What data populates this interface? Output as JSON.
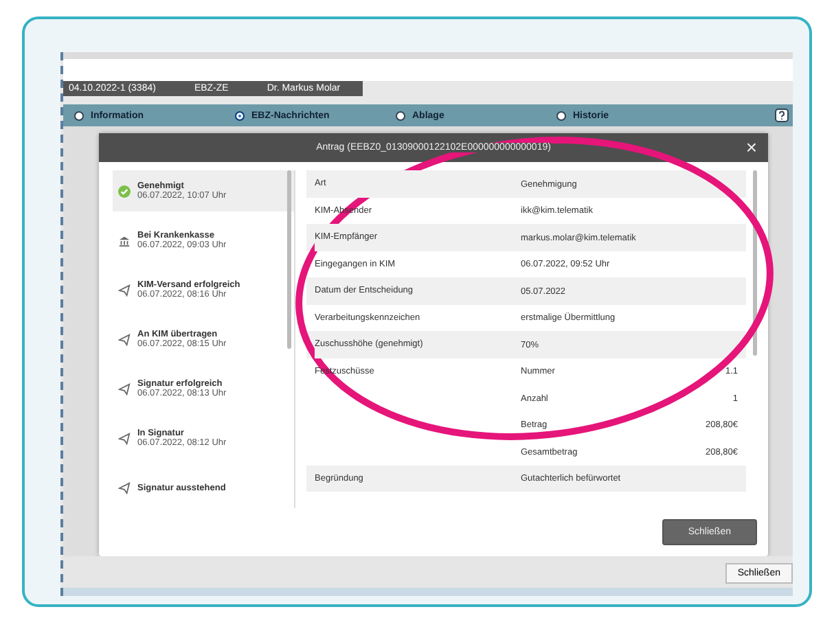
{
  "header": {
    "case": "04.10.2022-1 (3384)",
    "type": "EBZ-ZE",
    "doctor": "Dr. Markus Molar"
  },
  "tabs": [
    {
      "label": "Information",
      "selected": false
    },
    {
      "label": "EBZ-Nachrichten",
      "selected": true
    },
    {
      "label": "Ablage",
      "selected": false
    },
    {
      "label": "Historie",
      "selected": false
    }
  ],
  "dialog": {
    "title": "Antrag (EEBZ0_01309000122102E000000000000019)",
    "close": "×",
    "button": "Schließen"
  },
  "timeline": [
    {
      "kind": "done",
      "title": "Genehmigt",
      "time": "06.07.2022, 10:07 Uhr",
      "selected": true
    },
    {
      "kind": "bank",
      "title": "Bei Krankenkasse",
      "time": "06.07.2022, 09:03 Uhr",
      "selected": false
    },
    {
      "kind": "send",
      "title": "KIM-Versand erfolgreich",
      "time": "06.07.2022, 08:16 Uhr",
      "selected": false
    },
    {
      "kind": "send",
      "title": "An KIM übertragen",
      "time": "06.07.2022, 08:15 Uhr",
      "selected": false
    },
    {
      "kind": "send",
      "title": "Signatur erfolgreich",
      "time": "06.07.2022, 08:13 Uhr",
      "selected": false
    },
    {
      "kind": "send",
      "title": "In Signatur",
      "time": "06.07.2022, 08:12 Uhr",
      "selected": false
    },
    {
      "kind": "send",
      "title": "Signatur ausstehend",
      "selected": false
    }
  ],
  "details": [
    {
      "label": "Art",
      "value": "Genehmigung"
    },
    {
      "label": "KIM-Absender",
      "value": "ikk@kim.telematik"
    },
    {
      "label": "KIM-Empfänger",
      "value": "markus.molar@kim.telematik"
    },
    {
      "label": "Eingegangen in KIM",
      "value": "06.07.2022, 09:52 Uhr"
    },
    {
      "label": "Datum der Entscheidung",
      "value": "05.07.2022"
    },
    {
      "label": "Verarbeitungskennzeichen",
      "value": "erstmalige Übermittlung"
    },
    {
      "label": "Zuschusshöhe (genehmigt)",
      "value": "70%"
    },
    {
      "label": "Festzuschüsse",
      "subs": [
        {
          "name": "Nummer",
          "value": "1.1"
        },
        {
          "name": "Anzahl",
          "value": "1"
        },
        {
          "name": "Betrag",
          "value": "208,80€"
        },
        {
          "name": "Gesamtbetrag",
          "value": "208,80€"
        }
      ]
    },
    {
      "label": "Begründung",
      "value": "Gutachterlich befürwortet"
    }
  ],
  "footer_button": "Schließen"
}
